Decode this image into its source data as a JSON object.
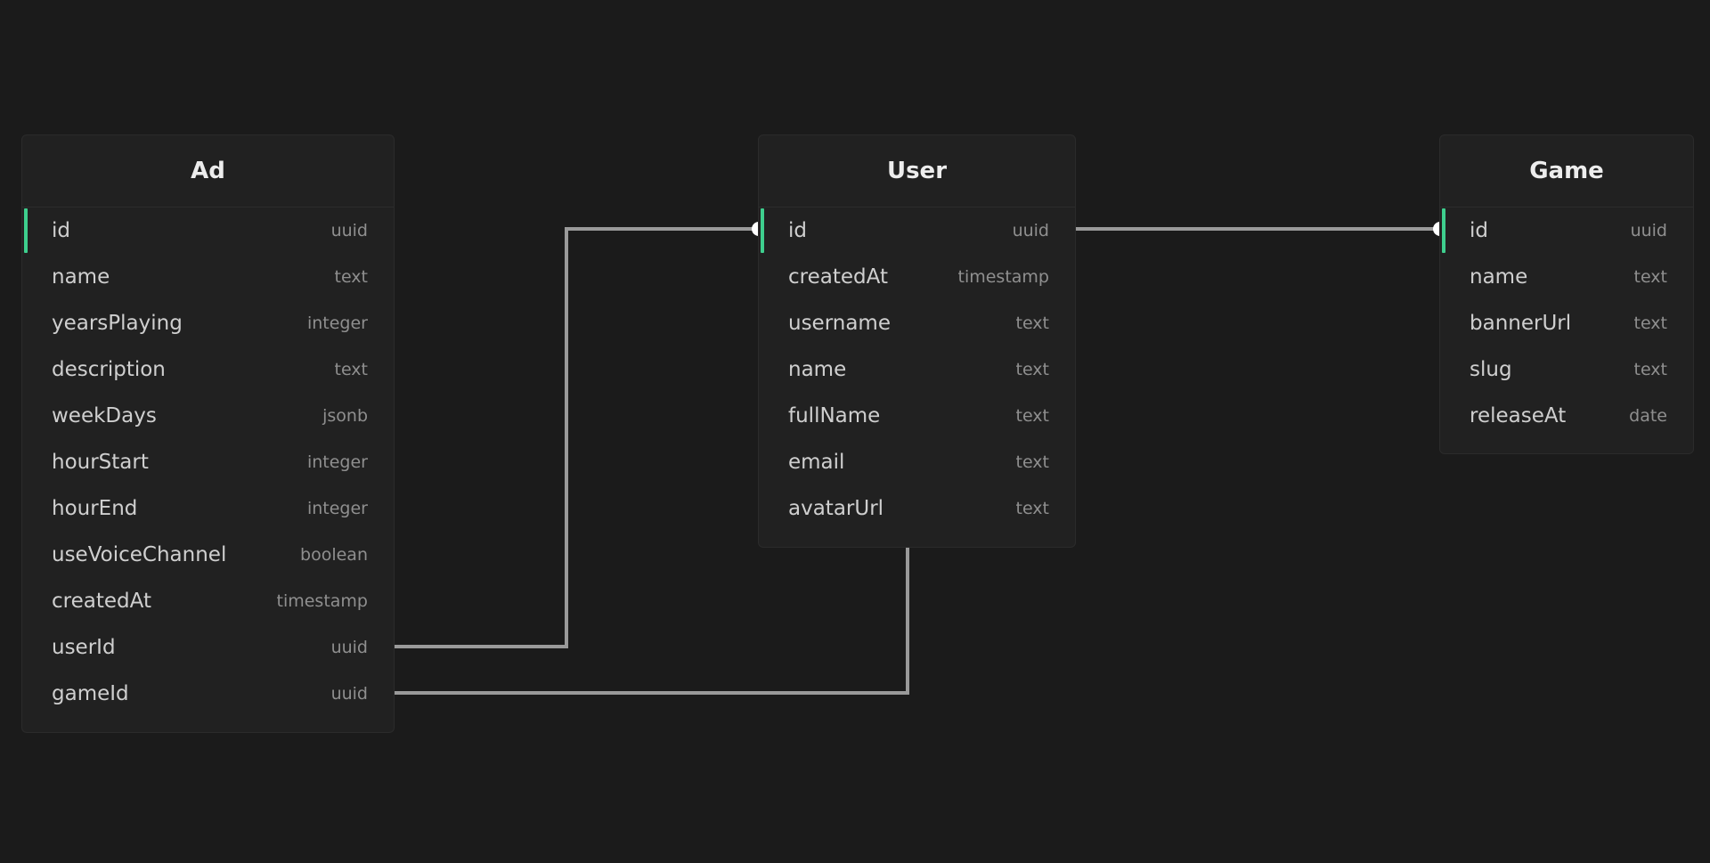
{
  "diagram": {
    "tables": [
      {
        "key": "ad",
        "title": "Ad",
        "columns": [
          {
            "name": "id",
            "type": "uuid",
            "primary": true
          },
          {
            "name": "name",
            "type": "text"
          },
          {
            "name": "yearsPlaying",
            "type": "integer"
          },
          {
            "name": "description",
            "type": "text"
          },
          {
            "name": "weekDays",
            "type": "jsonb"
          },
          {
            "name": "hourStart",
            "type": "integer"
          },
          {
            "name": "hourEnd",
            "type": "integer"
          },
          {
            "name": "useVoiceChannel",
            "type": "boolean"
          },
          {
            "name": "createdAt",
            "type": "timestamp"
          },
          {
            "name": "userId",
            "type": "uuid"
          },
          {
            "name": "gameId",
            "type": "uuid"
          }
        ]
      },
      {
        "key": "user",
        "title": "User",
        "columns": [
          {
            "name": "id",
            "type": "uuid",
            "primary": true
          },
          {
            "name": "createdAt",
            "type": "timestamp"
          },
          {
            "name": "username",
            "type": "text"
          },
          {
            "name": "name",
            "type": "text"
          },
          {
            "name": "fullName",
            "type": "text"
          },
          {
            "name": "email",
            "type": "text"
          },
          {
            "name": "avatarUrl",
            "type": "text"
          }
        ]
      },
      {
        "key": "game",
        "title": "Game",
        "columns": [
          {
            "name": "id",
            "type": "uuid",
            "primary": true
          },
          {
            "name": "name",
            "type": "text"
          },
          {
            "name": "bannerUrl",
            "type": "text"
          },
          {
            "name": "slug",
            "type": "text"
          },
          {
            "name": "releaseAt",
            "type": "date"
          }
        ]
      }
    ],
    "relationships": [
      {
        "from": "Ad.userId",
        "to": "User.id"
      },
      {
        "from": "Ad.gameId",
        "to": "User"
      },
      {
        "from": "User.id",
        "to": "Game.id"
      }
    ],
    "colors": {
      "background": "#1b1b1b",
      "panel": "#212121",
      "primary_key_accent": "#3ecf8e",
      "connector": "#9a9a9a"
    }
  }
}
